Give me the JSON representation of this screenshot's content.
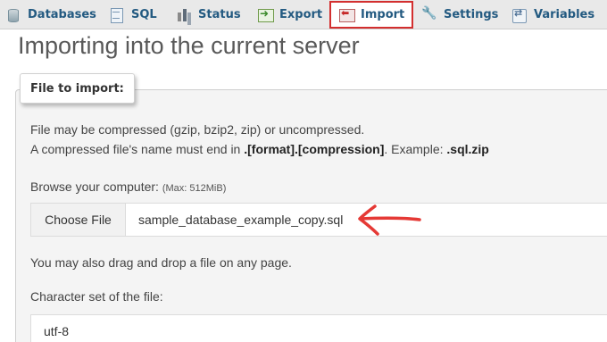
{
  "tabs": [
    {
      "label": "Databases",
      "icon": "database-icon"
    },
    {
      "label": "SQL",
      "icon": "sql-icon"
    },
    {
      "label": "Status",
      "icon": "status-icon"
    },
    {
      "label": "Export",
      "icon": "export-icon"
    },
    {
      "label": "Import",
      "icon": "import-icon",
      "active": true
    },
    {
      "label": "Settings",
      "icon": "settings-icon"
    },
    {
      "label": "Variables",
      "icon": "variables-icon"
    }
  ],
  "active_tab_highlight_color": "#d32f2f",
  "page_title": "Importing into the current server",
  "file_section": {
    "legend": "File to import:",
    "compression_line1": "File may be compressed (gzip, bzip2, zip) or uncompressed.",
    "compression_line2_prefix": "A compressed file's name must end in ",
    "compression_line2_format": ".[format].[compression]",
    "compression_line2_mid": ". Example: ",
    "compression_line2_example": ".sql.zip",
    "browse_label": "Browse your computer: ",
    "browse_max": "(Max: 512MiB)",
    "choose_file_button": "Choose File",
    "selected_file": "sample_database_example_copy.sql",
    "drag_drop_hint": "You may also drag and drop a file on any page.",
    "charset_label": "Character set of the file:",
    "charset_value": "utf-8"
  },
  "annotation_arrow_color": "#e53935"
}
